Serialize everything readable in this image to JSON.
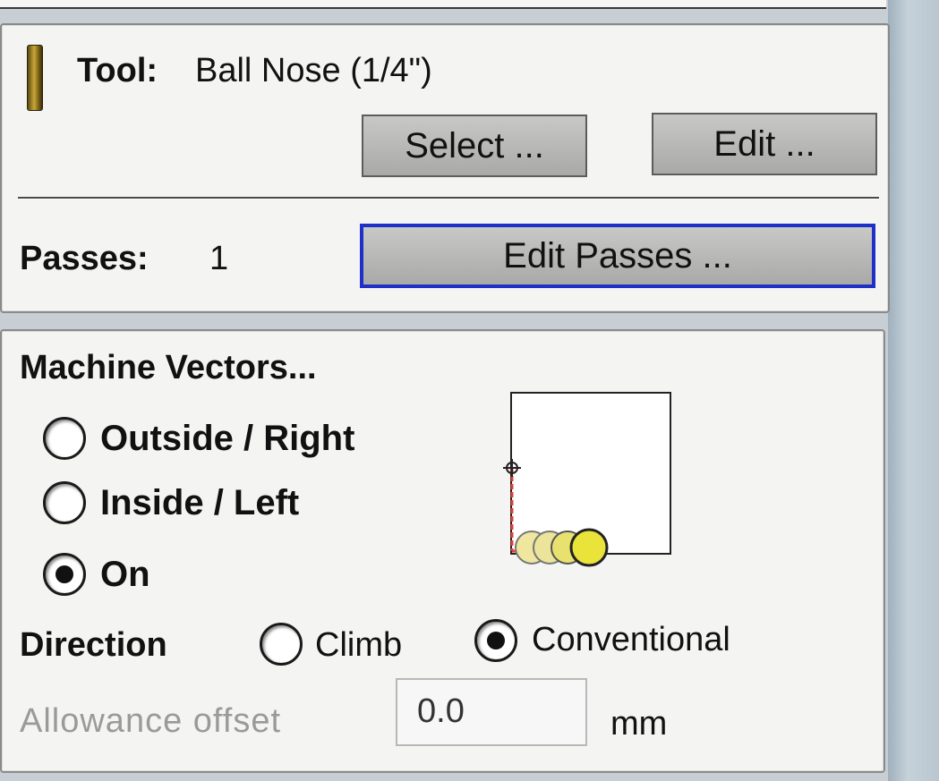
{
  "tool": {
    "label": "Tool:",
    "name": "Ball Nose (1/4\")",
    "select_label": "Select ...",
    "edit_label": "Edit ..."
  },
  "passes": {
    "label": "Passes:",
    "value": "1",
    "edit_label": "Edit Passes ..."
  },
  "machine_vectors": {
    "title": "Machine Vectors...",
    "options": [
      {
        "label": "Outside / Right",
        "selected": false
      },
      {
        "label": "Inside / Left",
        "selected": false
      },
      {
        "label": "On",
        "selected": true
      }
    ]
  },
  "direction": {
    "label": "Direction",
    "options": [
      {
        "label": "Climb",
        "selected": false
      },
      {
        "label": "Conventional",
        "selected": true
      }
    ]
  },
  "allowance": {
    "label": "Allowance offset",
    "value": "0.0",
    "unit": "mm"
  },
  "colors": {
    "tool_path": "#e33b3b",
    "cutter_fill": "#e9e33a",
    "focus_border": "#1e30c8"
  }
}
